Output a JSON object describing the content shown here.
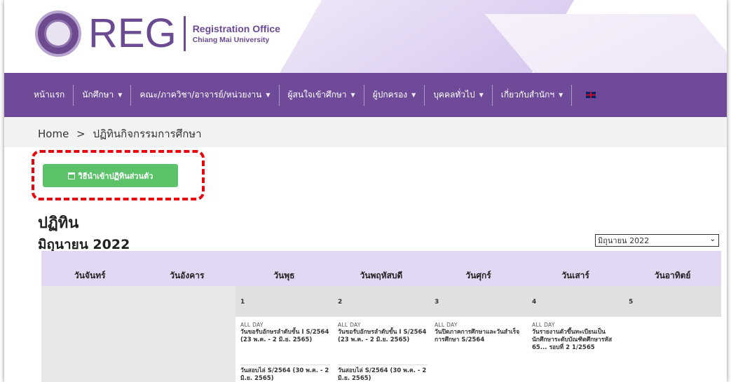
{
  "header": {
    "logo_text": "REG",
    "office_line1": "Registration Office",
    "office_line2": "Chiang Mai University"
  },
  "nav": [
    {
      "label": "หน้าแรก",
      "dropdown": false
    },
    {
      "label": "นักศึกษา",
      "dropdown": true
    },
    {
      "label": "คณะ/ภาควิชา/อาจารย์/หน่วยงาน",
      "dropdown": true
    },
    {
      "label": "ผู้สนใจเข้าศึกษา",
      "dropdown": true
    },
    {
      "label": "ผู้ปกครอง",
      "dropdown": true
    },
    {
      "label": "บุคคลทั่วไป",
      "dropdown": true
    },
    {
      "label": "เกี่ยวกับสำนักฯ",
      "dropdown": true
    },
    {
      "label": "",
      "dropdown": false,
      "icon": "uk-flag-icon"
    }
  ],
  "breadcrumb": {
    "home": "Home",
    "separator": ">",
    "current": "ปฏิทินกิจกรรมการศึกษา"
  },
  "import_button": "วิธีนำเข้าปฏิทินส่วนตัว",
  "page_title": "ปฏิทิน",
  "month_title": "มิถุนายน 2022",
  "month_select": "มิถุนายน 2022",
  "weekdays": [
    "วันจันทร์",
    "วันอังคาร",
    "วันพุธ",
    "วันพฤหัสบดี",
    "วันศุกร์",
    "วันเสาร์",
    "วันอาทิตย์"
  ],
  "dates": [
    "1",
    "2",
    "3",
    "4",
    "5"
  ],
  "events": [
    {
      "tag": "ALL DAY",
      "title": "วันขอรับอักษรลำดับขั้น I S/2564 (23 พ.ค. - 2 มิ.ย. 2565)",
      "second": "วันสอบไล่ S/2564 (30 พ.ค. - 2 มิ.ย. 2565)"
    },
    {
      "tag": "ALL DAY",
      "title": "วันขอรับอักษรลำดับขั้น I S/2564 (23 พ.ค. - 2 มิ.ย. 2565)",
      "second": "วันสอบไล่ S/2564 (30 พ.ค. - 2 มิ.ย. 2565)"
    },
    {
      "tag": "ALL DAY",
      "title": "วันปิดภาคการศึกษาและวันสำเร็จการศึกษา S/2564",
      "second": ""
    },
    {
      "tag": "ALL DAY",
      "title": "วันรายงานตัวขึ้นทะเบียนเป็นนักศึกษาระดับบัณฑิตศึกษารหัส 65... รอบที่ 2 1/2565",
      "second": ""
    }
  ]
}
